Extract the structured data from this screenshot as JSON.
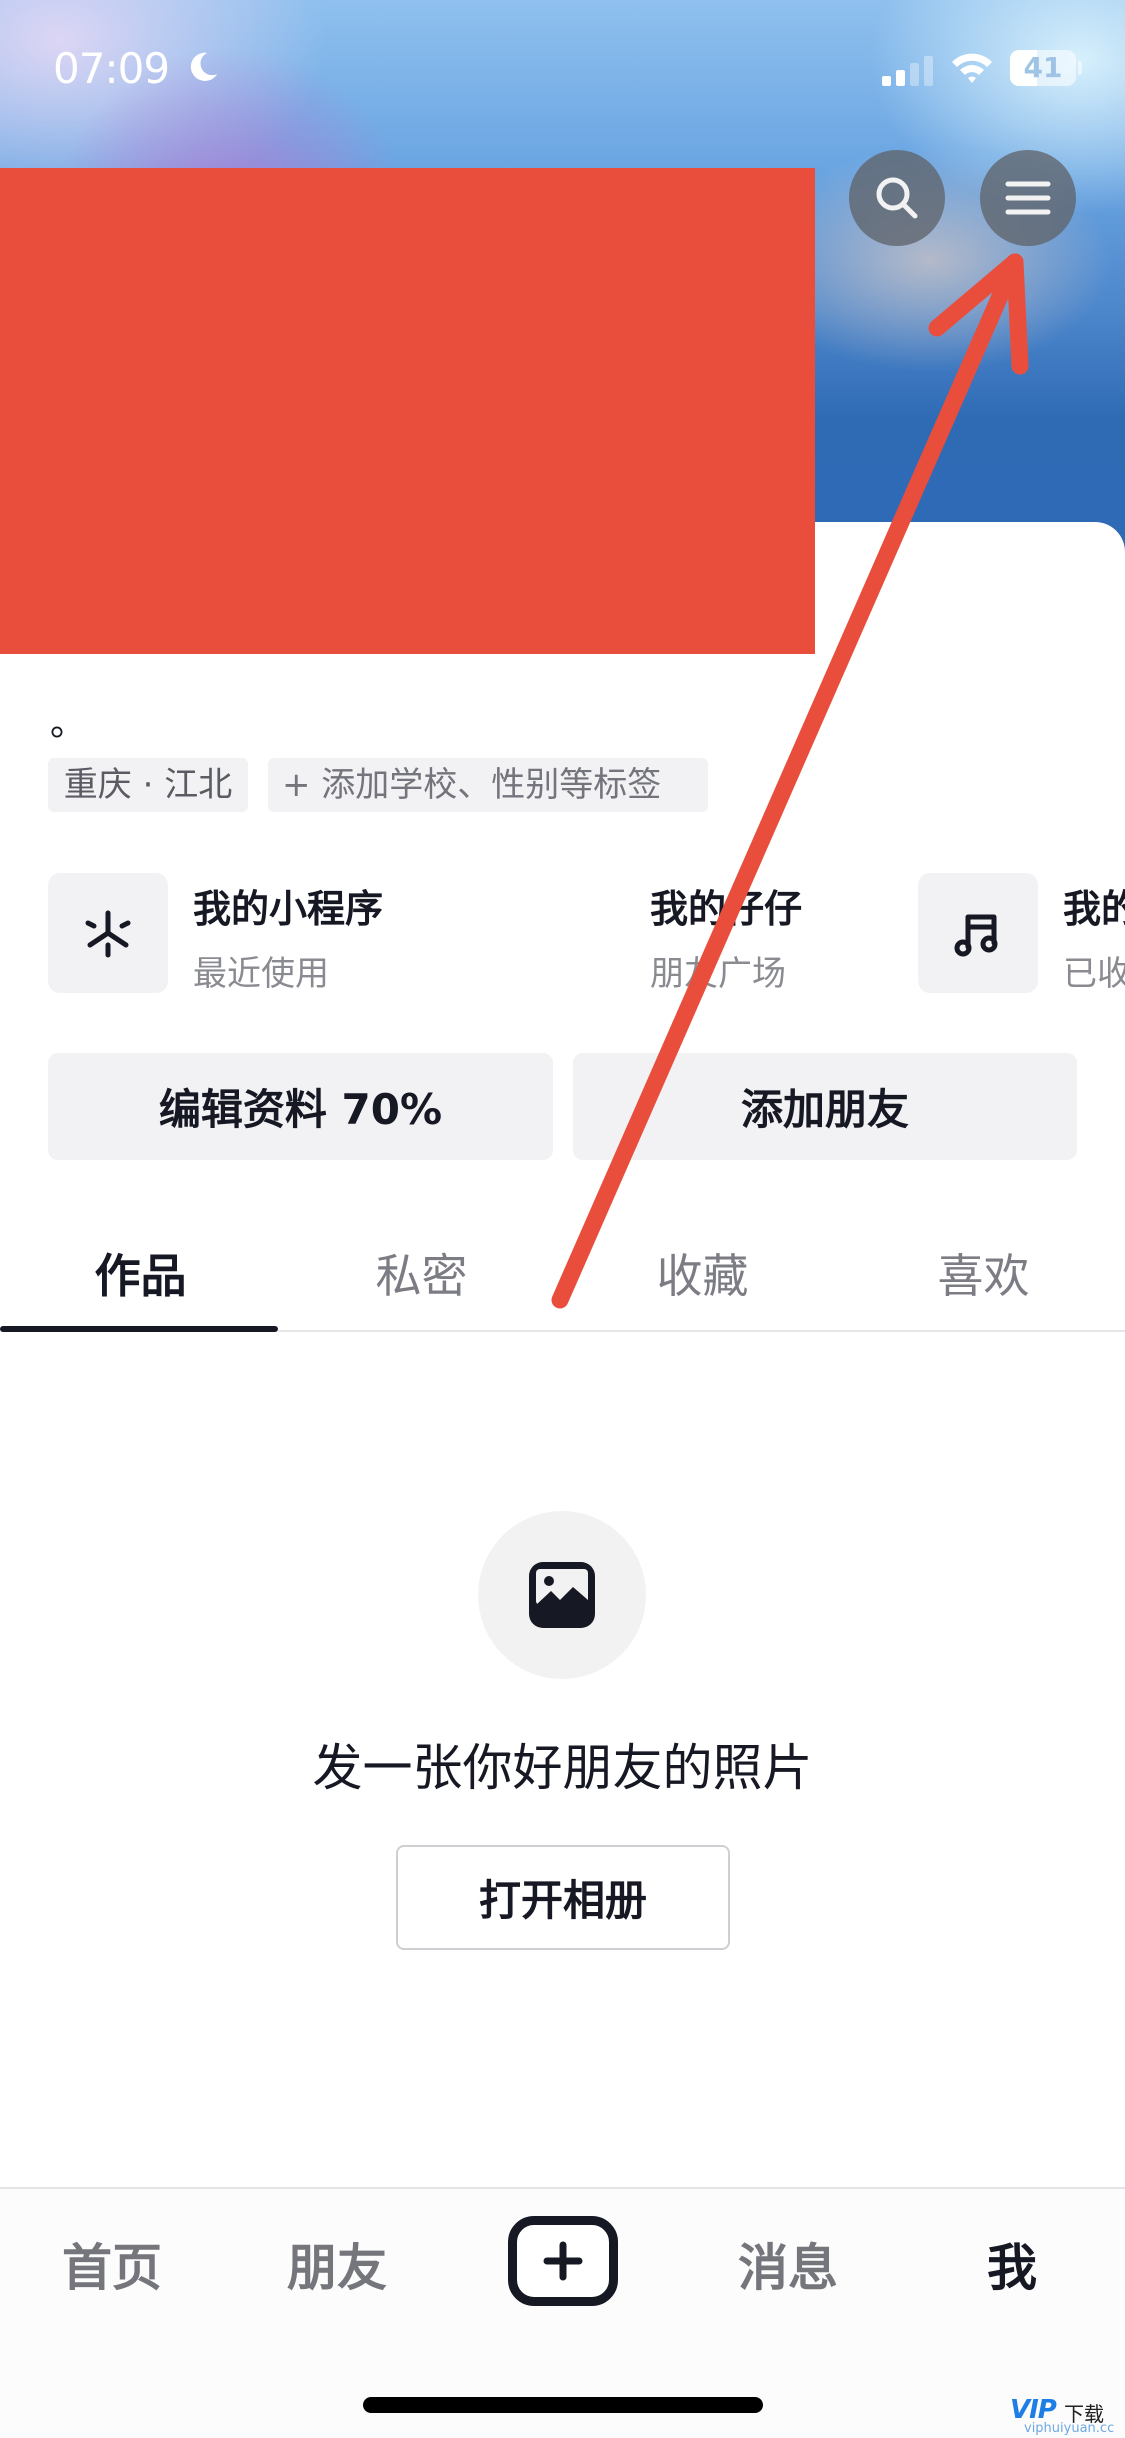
{
  "status_bar": {
    "time": "07:09",
    "focus_icon": "moon-icon",
    "signal_bars_active": 2,
    "signal_bars_total": 4,
    "wifi_icon": "wifi-icon",
    "battery_percent": 41,
    "battery_label": "41"
  },
  "header": {
    "search_icon": "search-icon",
    "menu_icon": "hamburger-menu-icon",
    "profile_info_redacted": true
  },
  "profile": {
    "bio": "。",
    "tags": [
      {
        "label": "重庆 · 江北"
      },
      {
        "label": "+ 添加学校、性别等标签"
      }
    ]
  },
  "shortcuts": [
    {
      "icon": "mini-program-icon",
      "title": "我的小程序",
      "subtitle": "最近使用"
    },
    {
      "icon": "",
      "title": "我的仔仔",
      "subtitle": "朋友广场"
    },
    {
      "icon": "music-note-icon",
      "title": "我的",
      "subtitle": "已收"
    }
  ],
  "actions": {
    "edit_profile": "编辑资料 70%",
    "edit_profile_completion_percent": 70,
    "add_friend": "添加朋友"
  },
  "content_tabs": [
    {
      "label": "作品",
      "active": true
    },
    {
      "label": "私密",
      "active": false
    },
    {
      "label": "收藏",
      "active": false
    },
    {
      "label": "喜欢",
      "active": false
    }
  ],
  "empty_state": {
    "icon": "image-icon",
    "title": "发一张你好朋友的照片",
    "button": "打开相册"
  },
  "bottom_nav": [
    {
      "label": "首页",
      "active": false
    },
    {
      "label": "朋友",
      "active": false
    },
    {
      "label": "+",
      "icon": "plus-icon",
      "active": false
    },
    {
      "label": "消息",
      "active": false
    },
    {
      "label": "我",
      "active": true
    }
  ],
  "annotation": {
    "type": "red-arrow",
    "points_to": "hamburger-menu-button",
    "color": "#e94e3d"
  },
  "watermark": {
    "logo": "VIP",
    "text": "下载",
    "url": "viphuiyuan.cc"
  },
  "colors": {
    "redaction": "#e94e3d",
    "hero_blue": "#2f6bb5",
    "text_primary": "#161823",
    "text_secondary": "#8a8b91",
    "chip_bg": "#f2f2f4"
  }
}
